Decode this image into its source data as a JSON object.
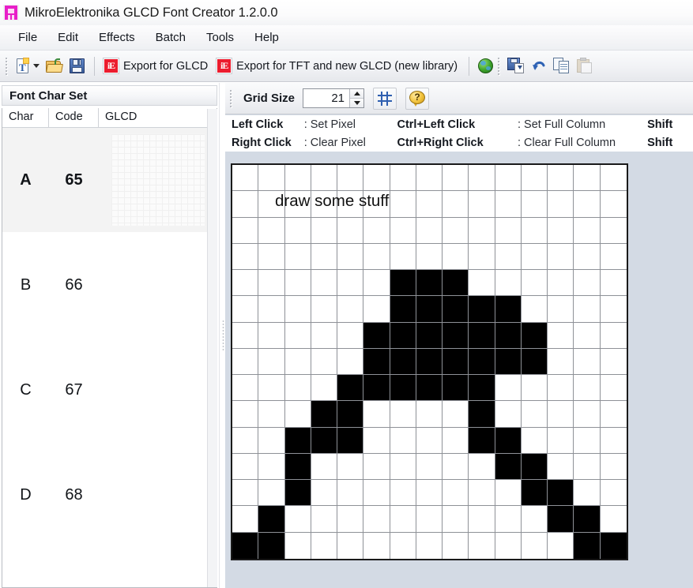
{
  "window": {
    "title": "MikroElektronika GLCD Font Creator 1.2.0.0",
    "icon": "font-app-icon"
  },
  "menu": {
    "items": [
      {
        "label": "File"
      },
      {
        "label": "Edit"
      },
      {
        "label": "Effects"
      },
      {
        "label": "Batch"
      },
      {
        "label": "Tools"
      },
      {
        "label": "Help"
      }
    ]
  },
  "toolbar": {
    "new_icon": "new-font-icon",
    "open_icon": "open-folder-icon",
    "save_icon": "save-floppy-icon",
    "export_glcd_icon": "export-glcd-icon",
    "export_glcd_label": "Export for GLCD",
    "export_tft_icon": "export-tft-icon",
    "export_tft_label": "Export for TFT and new GLCD (new library)",
    "globe_icon": "globe-icon",
    "save_as_icon": "save-as-icon",
    "undo_icon": "undo-icon",
    "copy_icon": "copy-icon",
    "paste_icon": "paste-icon"
  },
  "left_panel": {
    "title": "Font Char Set",
    "columns": [
      "Char",
      "Code",
      "GLCD"
    ],
    "rows": [
      {
        "char": "A",
        "code": "65",
        "selected": true,
        "preview": "visible"
      },
      {
        "char": "B",
        "code": "66",
        "selected": false,
        "preview": "hidden"
      },
      {
        "char": "C",
        "code": "67",
        "selected": false,
        "preview": "hidden"
      },
      {
        "char": "D",
        "code": "68",
        "selected": false,
        "preview": "hidden"
      }
    ]
  },
  "grid_size_bar": {
    "label": "Grid Size",
    "value": "21",
    "toggle_grid_icon": "grid-toggle-icon",
    "help_icon": "help-icon"
  },
  "legend": {
    "rows": [
      {
        "key1": "Left Click",
        "val1": ": Set Pixel",
        "key2": "Ctrl+Left Click",
        "val2": ": Set Full Column",
        "key3": "Shift"
      },
      {
        "key1": "Right Click",
        "val1": ": Clear Pixel",
        "key2": "Ctrl+Right Click",
        "val2": ": Clear Full Column",
        "key3": "Shift"
      }
    ]
  },
  "canvas": {
    "annotation": "draw some stuff",
    "columns": 15,
    "rows": 15,
    "on_color": "#000000",
    "off_color": "#ffffff",
    "pixels": [
      [
        0,
        0,
        0,
        0,
        0,
        0,
        0,
        0,
        0,
        0,
        0,
        0,
        0,
        0,
        0
      ],
      [
        0,
        0,
        0,
        0,
        0,
        0,
        0,
        0,
        0,
        0,
        0,
        0,
        0,
        0,
        0
      ],
      [
        0,
        0,
        0,
        0,
        0,
        0,
        0,
        0,
        0,
        0,
        0,
        0,
        0,
        0,
        0
      ],
      [
        0,
        0,
        0,
        0,
        0,
        0,
        0,
        0,
        0,
        0,
        0,
        0,
        0,
        0,
        0
      ],
      [
        0,
        0,
        0,
        0,
        0,
        0,
        1,
        1,
        1,
        0,
        0,
        0,
        0,
        0,
        0
      ],
      [
        0,
        0,
        0,
        0,
        0,
        0,
        1,
        1,
        1,
        1,
        1,
        0,
        0,
        0,
        0
      ],
      [
        0,
        0,
        0,
        0,
        0,
        1,
        1,
        1,
        1,
        1,
        1,
        1,
        0,
        0,
        0
      ],
      [
        0,
        0,
        0,
        0,
        0,
        1,
        1,
        1,
        1,
        1,
        1,
        1,
        0,
        0,
        0
      ],
      [
        0,
        0,
        0,
        0,
        1,
        1,
        1,
        1,
        1,
        1,
        0,
        0,
        0,
        0,
        0
      ],
      [
        0,
        0,
        0,
        1,
        1,
        0,
        0,
        0,
        0,
        1,
        0,
        0,
        0,
        0,
        0
      ],
      [
        0,
        0,
        1,
        1,
        1,
        0,
        0,
        0,
        0,
        1,
        1,
        0,
        0,
        0,
        0
      ],
      [
        0,
        0,
        1,
        0,
        0,
        0,
        0,
        0,
        0,
        0,
        1,
        1,
        0,
        0,
        0
      ],
      [
        0,
        0,
        1,
        0,
        0,
        0,
        0,
        0,
        0,
        0,
        0,
        1,
        1,
        0,
        0
      ],
      [
        0,
        1,
        0,
        0,
        0,
        0,
        0,
        0,
        0,
        0,
        0,
        0,
        1,
        1,
        0
      ],
      [
        1,
        1,
        0,
        0,
        0,
        0,
        0,
        0,
        0,
        0,
        0,
        0,
        0,
        1,
        1
      ]
    ]
  }
}
